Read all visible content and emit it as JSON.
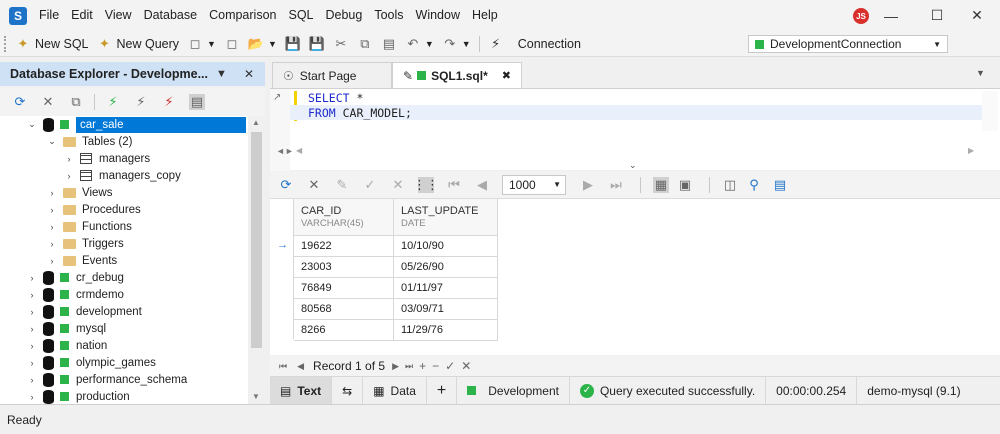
{
  "menu": [
    "File",
    "Edit",
    "View",
    "Database",
    "Comparison",
    "SQL",
    "Debug",
    "Tools",
    "Window",
    "Help"
  ],
  "user_initials": "JS",
  "toolbar": {
    "new_sql": "New SQL",
    "new_query": "New Query",
    "connection_label": "Connection",
    "connection_value": "DevelopmentConnection"
  },
  "explorer": {
    "title": "Database Explorer - Developme...",
    "tree": [
      {
        "label": "car_sale",
        "type": "db",
        "selected": true
      },
      {
        "label": "Tables (2)",
        "type": "folder"
      },
      {
        "label": "managers",
        "type": "table"
      },
      {
        "label": "managers_copy",
        "type": "table"
      },
      {
        "label": "Views",
        "type": "folder"
      },
      {
        "label": "Procedures",
        "type": "folder"
      },
      {
        "label": "Functions",
        "type": "folder"
      },
      {
        "label": "Triggers",
        "type": "folder"
      },
      {
        "label": "Events",
        "type": "folder"
      },
      {
        "label": "cr_debug",
        "type": "db"
      },
      {
        "label": "crmdemo",
        "type": "db"
      },
      {
        "label": "development",
        "type": "db"
      },
      {
        "label": "mysql",
        "type": "db"
      },
      {
        "label": "nation",
        "type": "db"
      },
      {
        "label": "olympic_games",
        "type": "db"
      },
      {
        "label": "performance_schema",
        "type": "db"
      },
      {
        "label": "production",
        "type": "db"
      }
    ]
  },
  "tabs": [
    {
      "label": "Start Page"
    },
    {
      "label": "SQL1.sql*"
    }
  ],
  "editor": {
    "line1_kw": "SELECT",
    "line1_rest": " *",
    "line2_kw": "FROM",
    "line2_rest": " CAR_MODEL;"
  },
  "grid_toolbar": {
    "rows_value": "1000"
  },
  "grid": {
    "columns": [
      {
        "name": "CAR_ID",
        "type": "VARCHAR(45)"
      },
      {
        "name": "LAST_UPDATE",
        "type": "DATE"
      }
    ],
    "rows": [
      [
        "19622",
        "10/10/90"
      ],
      [
        "23003",
        "05/26/90"
      ],
      [
        "76849",
        "01/11/97"
      ],
      [
        "80568",
        "03/09/71"
      ],
      [
        "8266",
        "11/29/76"
      ]
    ]
  },
  "navigator": {
    "record_text": "Record 1 of 5"
  },
  "bottom": {
    "text_tab": "Text",
    "data_tab": "Data",
    "connection": "Development",
    "status": "Query executed successfully.",
    "time": "00:00:00.254",
    "server": "demo-mysql (9.1)"
  },
  "statusbar": {
    "text": "Ready"
  }
}
